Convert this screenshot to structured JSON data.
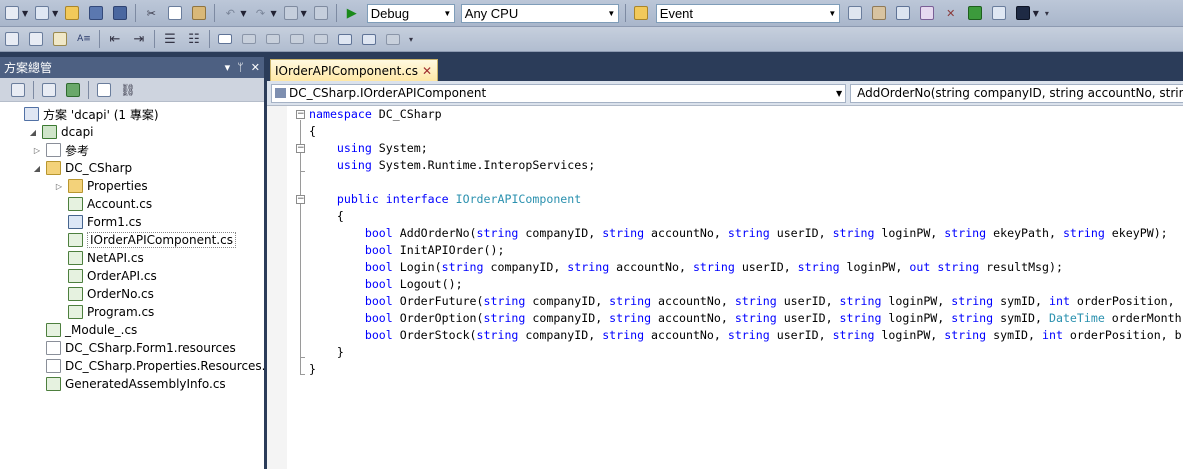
{
  "toolbar": {
    "config_combo": "Debug",
    "platform_combo": "Any CPU",
    "find_combo": "Event"
  },
  "solution_explorer": {
    "title": "方案總管",
    "pin_glyph": "▾",
    "autohide_glyph": "ᛘ",
    "close_glyph": "✕",
    "tree": [
      {
        "label": "方案 'dcapi' (1 專案)",
        "level": 0,
        "icon": "solution",
        "expander": ""
      },
      {
        "label": "dcapi",
        "level": 1,
        "icon": "project",
        "expander": "◢"
      },
      {
        "label": "參考",
        "level": 2,
        "icon": "references",
        "expander": "▷"
      },
      {
        "label": "DC_CSharp",
        "level": 2,
        "icon": "folder",
        "expander": "◢"
      },
      {
        "label": "Properties",
        "level": 3,
        "icon": "folder",
        "expander": "▷"
      },
      {
        "label": "Account.cs",
        "level": 3,
        "icon": "cs",
        "expander": ""
      },
      {
        "label": "Form1.cs",
        "level": 3,
        "icon": "form",
        "expander": ""
      },
      {
        "label": "IOrderAPIComponent.cs",
        "level": 3,
        "icon": "cs",
        "expander": "",
        "selected": true
      },
      {
        "label": "NetAPI.cs",
        "level": 3,
        "icon": "cs",
        "expander": ""
      },
      {
        "label": "OrderAPI.cs",
        "level": 3,
        "icon": "cs",
        "expander": ""
      },
      {
        "label": "OrderNo.cs",
        "level": 3,
        "icon": "cs",
        "expander": ""
      },
      {
        "label": "Program.cs",
        "level": 3,
        "icon": "cs",
        "expander": ""
      },
      {
        "label": "_Module_.cs",
        "level": 2,
        "icon": "cs",
        "expander": ""
      },
      {
        "label": "DC_CSharp.Form1.resources",
        "level": 2,
        "icon": "doc",
        "expander": ""
      },
      {
        "label": "DC_CSharp.Properties.Resources.resources",
        "level": 2,
        "icon": "doc",
        "expander": ""
      },
      {
        "label": "GeneratedAssemblyInfo.cs",
        "level": 2,
        "icon": "cs",
        "expander": ""
      }
    ]
  },
  "editor": {
    "tab_label": "IOrderAPIComponent.cs",
    "tab_close": "✕",
    "type_combo": "DC_CSharp.IOrderAPIComponent",
    "member_combo": "AddOrderNo(string companyID, string accountNo, string userID, string loginPW, string ekeyPath, string ekeyPW)",
    "lines": [
      [
        [
          "kw",
          "namespace"
        ],
        [
          "p",
          " DC_CSharp"
        ]
      ],
      [
        [
          "p",
          "{"
        ]
      ],
      [
        [
          "p",
          "    "
        ],
        [
          "kw",
          "using"
        ],
        [
          "p",
          " System;"
        ]
      ],
      [
        [
          "p",
          "    "
        ],
        [
          "kw",
          "using"
        ],
        [
          "p",
          " System.Runtime.InteropServices;"
        ]
      ],
      [
        [
          "p",
          ""
        ]
      ],
      [
        [
          "p",
          "    "
        ],
        [
          "kw",
          "public"
        ],
        [
          "p",
          " "
        ],
        [
          "kw",
          "interface"
        ],
        [
          "p",
          " "
        ],
        [
          "ty",
          "IOrderAPIComponent"
        ]
      ],
      [
        [
          "p",
          "    {"
        ]
      ],
      [
        [
          "p",
          "        "
        ],
        [
          "kw",
          "bool"
        ],
        [
          "p",
          " AddOrderNo("
        ],
        [
          "kw",
          "string"
        ],
        [
          "p",
          " companyID, "
        ],
        [
          "kw",
          "string"
        ],
        [
          "p",
          " accountNo, "
        ],
        [
          "kw",
          "string"
        ],
        [
          "p",
          " userID, "
        ],
        [
          "kw",
          "string"
        ],
        [
          "p",
          " loginPW, "
        ],
        [
          "kw",
          "string"
        ],
        [
          "p",
          " ekeyPath, "
        ],
        [
          "kw",
          "string"
        ],
        [
          "p",
          " ekeyPW);"
        ]
      ],
      [
        [
          "p",
          "        "
        ],
        [
          "kw",
          "bool"
        ],
        [
          "p",
          " InitAPIOrder();"
        ]
      ],
      [
        [
          "p",
          "        "
        ],
        [
          "kw",
          "bool"
        ],
        [
          "p",
          " Login("
        ],
        [
          "kw",
          "string"
        ],
        [
          "p",
          " companyID, "
        ],
        [
          "kw",
          "string"
        ],
        [
          "p",
          " accountNo, "
        ],
        [
          "kw",
          "string"
        ],
        [
          "p",
          " userID, "
        ],
        [
          "kw",
          "string"
        ],
        [
          "p",
          " loginPW, "
        ],
        [
          "kw",
          "out"
        ],
        [
          "p",
          " "
        ],
        [
          "kw",
          "string"
        ],
        [
          "p",
          " resultMsg);"
        ]
      ],
      [
        [
          "p",
          "        "
        ],
        [
          "kw",
          "bool"
        ],
        [
          "p",
          " Logout();"
        ]
      ],
      [
        [
          "p",
          "        "
        ],
        [
          "kw",
          "bool"
        ],
        [
          "p",
          " OrderFuture("
        ],
        [
          "kw",
          "string"
        ],
        [
          "p",
          " companyID, "
        ],
        [
          "kw",
          "string"
        ],
        [
          "p",
          " accountNo, "
        ],
        [
          "kw",
          "string"
        ],
        [
          "p",
          " userID, "
        ],
        [
          "kw",
          "string"
        ],
        [
          "p",
          " loginPW, "
        ],
        [
          "kw",
          "string"
        ],
        [
          "p",
          " symID, "
        ],
        [
          "kw",
          "int"
        ],
        [
          "p",
          " orderPosition, "
        ]
      ],
      [
        [
          "p",
          "        "
        ],
        [
          "kw",
          "bool"
        ],
        [
          "p",
          " OrderOption("
        ],
        [
          "kw",
          "string"
        ],
        [
          "p",
          " companyID, "
        ],
        [
          "kw",
          "string"
        ],
        [
          "p",
          " accountNo, "
        ],
        [
          "kw",
          "string"
        ],
        [
          "p",
          " userID, "
        ],
        [
          "kw",
          "string"
        ],
        [
          "p",
          " loginPW, "
        ],
        [
          "kw",
          "string"
        ],
        [
          "p",
          " symID, "
        ],
        [
          "ty",
          "DateTime"
        ],
        [
          "p",
          " orderMonth"
        ]
      ],
      [
        [
          "p",
          "        "
        ],
        [
          "kw",
          "bool"
        ],
        [
          "p",
          " OrderStock("
        ],
        [
          "kw",
          "string"
        ],
        [
          "p",
          " companyID, "
        ],
        [
          "kw",
          "string"
        ],
        [
          "p",
          " accountNo, "
        ],
        [
          "kw",
          "string"
        ],
        [
          "p",
          " userID, "
        ],
        [
          "kw",
          "string"
        ],
        [
          "p",
          " loginPW, "
        ],
        [
          "kw",
          "string"
        ],
        [
          "p",
          " symID, "
        ],
        [
          "kw",
          "int"
        ],
        [
          "p",
          " orderPosition, b"
        ]
      ],
      [
        [
          "p",
          "    }"
        ]
      ],
      [
        [
          "p",
          "}"
        ]
      ]
    ]
  }
}
